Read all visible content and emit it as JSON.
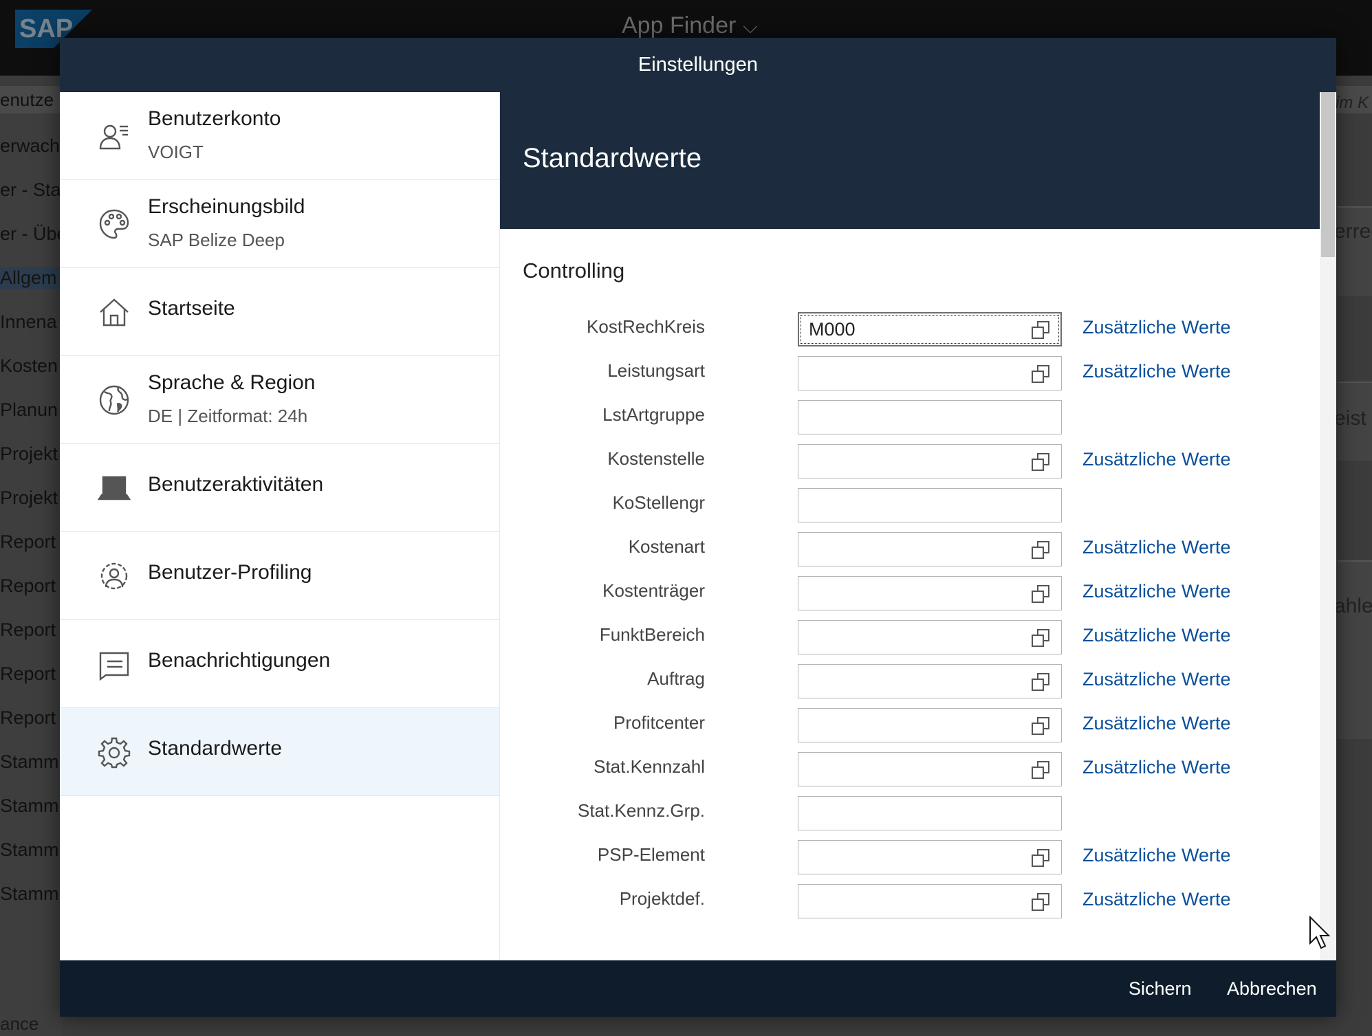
{
  "background": {
    "logo_text": "SAP",
    "app_title": "App Finder",
    "subbar_left": "enutze",
    "subbar_right": "im K",
    "sidebar_items": [
      "erwach",
      "er - Star",
      "er - Übe",
      "Allgem",
      "Innena",
      "Kosten",
      "Planun",
      "Projekt",
      "Projekt",
      "Report",
      "Report",
      "Report",
      "Report",
      "Report",
      "Stamm",
      "Stamm",
      "Stamm",
      "Stamm"
    ],
    "bottom_text": "ance",
    "right_fragments": [
      "erred",
      "eist",
      "ahle"
    ]
  },
  "dialog": {
    "title": "Einstellungen",
    "nav": [
      {
        "title": "Benutzerkonto",
        "subtitle": "VOIGT",
        "icon": "user-account-icon"
      },
      {
        "title": "Erscheinungsbild",
        "subtitle": "SAP Belize Deep",
        "icon": "palette-icon"
      },
      {
        "title": "Startseite",
        "subtitle": "",
        "icon": "home-icon"
      },
      {
        "title": "Sprache & Region",
        "subtitle": "DE | Zeitformat: 24h",
        "icon": "globe-icon"
      },
      {
        "title": "Benutzeraktivitäten",
        "subtitle": "",
        "icon": "laptop-icon"
      },
      {
        "title": "Benutzer-Profiling",
        "subtitle": "",
        "icon": "user-settings-icon"
      },
      {
        "title": "Benachrichtigungen",
        "subtitle": "",
        "icon": "notification-icon"
      },
      {
        "title": "Standardwerte",
        "subtitle": "",
        "icon": "gear-icon"
      }
    ],
    "content": {
      "title": "Standardwerte",
      "section": "Controlling",
      "more_values_label": "Zusätzliche Werte",
      "fields": [
        {
          "label": "KostRechKreis",
          "value": "M000",
          "value_help": true
        },
        {
          "label": "Leistungsart",
          "value": "",
          "value_help": true
        },
        {
          "label": "LstArtgruppe",
          "value": "",
          "value_help": false
        },
        {
          "label": "Kostenstelle",
          "value": "",
          "value_help": true
        },
        {
          "label": "KoStellengr",
          "value": "",
          "value_help": false
        },
        {
          "label": "Kostenart",
          "value": "",
          "value_help": true
        },
        {
          "label": "Kostenträger",
          "value": "",
          "value_help": true
        },
        {
          "label": "FunktBereich",
          "value": "",
          "value_help": true
        },
        {
          "label": "Auftrag",
          "value": "",
          "value_help": true
        },
        {
          "label": "Profitcenter",
          "value": "",
          "value_help": true
        },
        {
          "label": "Stat.Kennzahl",
          "value": "",
          "value_help": true
        },
        {
          "label": "Stat.Kennz.Grp.",
          "value": "",
          "value_help": false
        },
        {
          "label": "PSP-Element",
          "value": "",
          "value_help": true
        },
        {
          "label": "Projektdef.",
          "value": "",
          "value_help": true
        }
      ]
    },
    "footer": {
      "save_label": "Sichern",
      "cancel_label": "Abbrechen"
    }
  },
  "colors": {
    "header": "#1c2c3e",
    "footer": "#0f1c2b",
    "link": "#0a4f9c",
    "selected_nav": "#eef6fc"
  }
}
